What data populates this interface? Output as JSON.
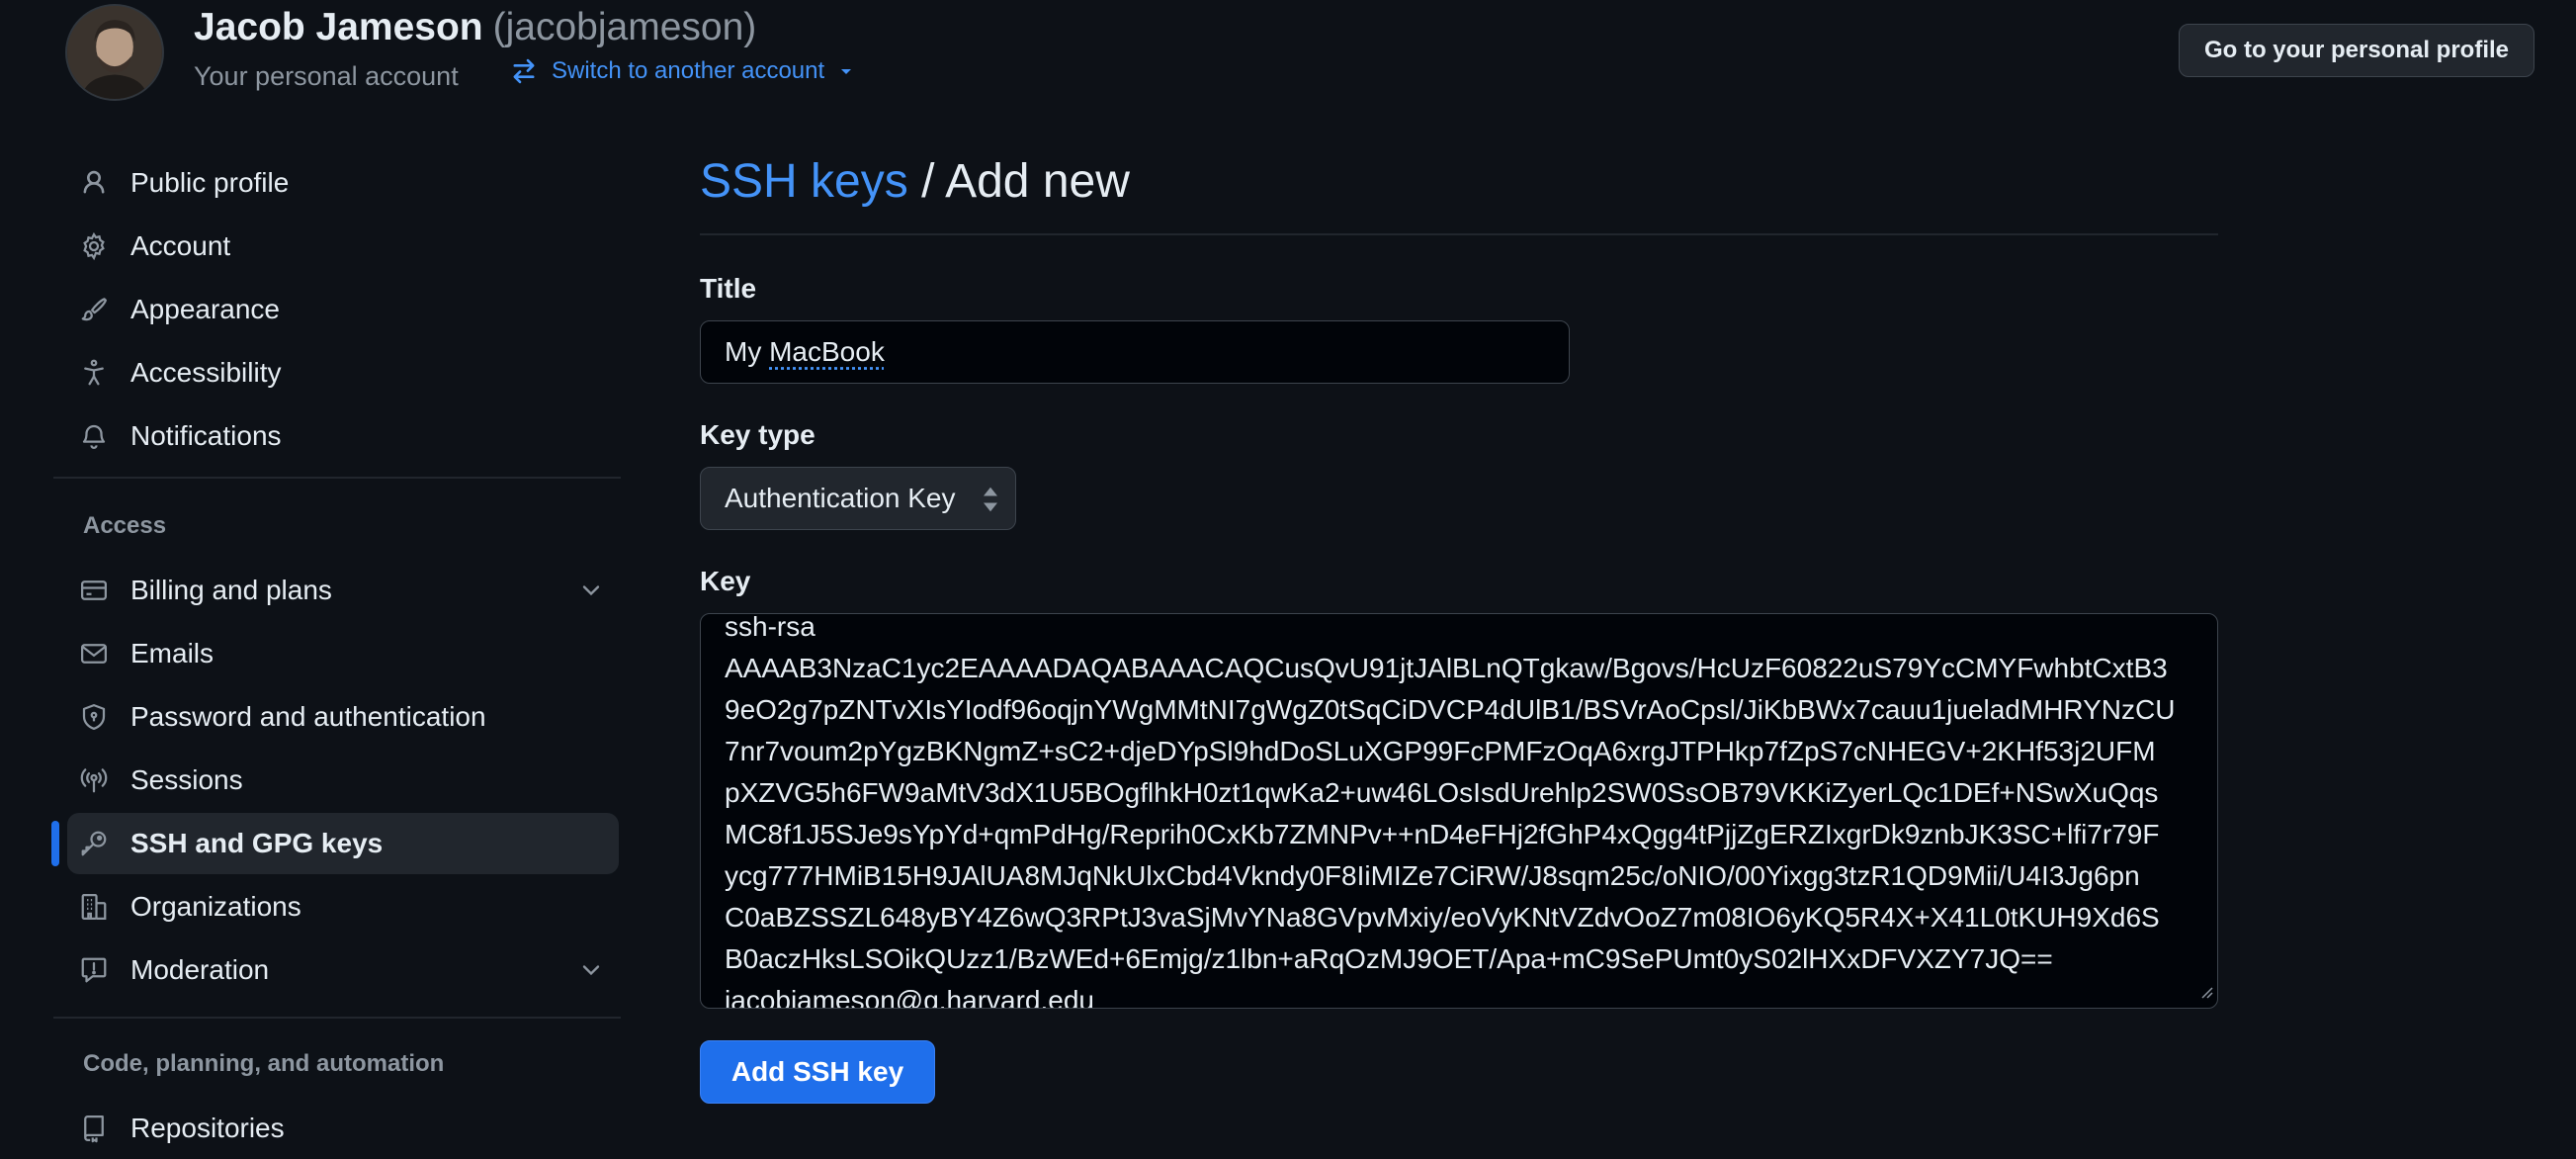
{
  "header": {
    "display_name": "Jacob Jameson",
    "login": "(jacobjameson)",
    "subtitle": "Your personal account",
    "switch_label": "Switch to another account",
    "profile_button": "Go to your personal profile"
  },
  "sidebar": {
    "items": [
      {
        "label": "Public profile",
        "icon": "person-icon"
      },
      {
        "label": "Account",
        "icon": "gear-icon"
      },
      {
        "label": "Appearance",
        "icon": "paintbrush-icon"
      },
      {
        "label": "Accessibility",
        "icon": "accessibility-icon"
      },
      {
        "label": "Notifications",
        "icon": "bell-icon"
      }
    ],
    "access_title": "Access",
    "access_items": [
      {
        "label": "Billing and plans",
        "icon": "credit-card-icon",
        "expandable": true
      },
      {
        "label": "Emails",
        "icon": "mail-icon"
      },
      {
        "label": "Password and authentication",
        "icon": "shield-lock-icon"
      },
      {
        "label": "Sessions",
        "icon": "broadcast-icon"
      },
      {
        "label": "SSH and GPG keys",
        "icon": "key-icon",
        "active": true
      },
      {
        "label": "Organizations",
        "icon": "organization-icon"
      },
      {
        "label": "Moderation",
        "icon": "report-icon",
        "expandable": true
      }
    ],
    "code_title": "Code, planning, and automation",
    "code_items": [
      {
        "label": "Repositories",
        "icon": "repo-icon"
      }
    ]
  },
  "main": {
    "breadcrumb_link": "SSH keys",
    "breadcrumb_sep": " / ",
    "breadcrumb_current": "Add new",
    "title_label": "Title",
    "title_value_prefix": "My ",
    "title_value_word": "MacBook",
    "key_type_label": "Key type",
    "key_type_value": "Authentication Key",
    "key_label": "Key",
    "key_lines": [
      "ssh-rsa",
      "AAAAB3NzaC1yc2EAAAADAQABAAACAQCusQvU91jtJAlBLnQTgkaw/Bgovs/HcUzF60822uS79YcCMYFwhbtCxtB3",
      "9eO2g7pZNTvXIsYIodf96oqjnYWgMMtNI7gWgZ0tSqCiDVCP4dUlB1/BSVrAoCpsl/JiKbBWx7cauu1jueladMHRYNzCU",
      "7nr7voum2pYgzBKNgmZ+sC2+djeDYpSl9hdDoSLuXGP99FcPMFzOqA6xrgJTPHkp7fZpS7cNHEGV+2KHf53j2UFM",
      "pXZVG5h6FW9aMtV3dX1U5BOgflhkH0zt1qwKa2+uw46LOsIsdUrehlp2SW0SsOB79VKKiZyerLQc1DEf+NSwXuQqs",
      "MC8f1J5SJe9sYpYd+qmPdHg/Reprih0CxKb7ZMNPv++nD4eFHj2fGhP4xQgg4tPjjZgERZIxgrDk9znbJK3SC+lfi7r79F",
      "ycg777HMiB15H9JAlUA8MJqNkUlxCbd4Vkndy0F8IiMIZe7CiRW/J8sqm25c/oNIO/00Yixgg3tzR1QD9Mii/U4I3Jg6pn",
      "C0aBZSSZL648yBY4Z6wQ3RPtJ3vaSjMvYNa8GVpvMxiy/eoVyKNtVZdvOoZ7m08IO6yKQ5R4X+X41L0tKUH9Xd6S",
      "B0aczHksLSOikQUzz1/BzWEd+6Emjg/z1lbn+aRqOzMJ9OET/Apa+mC9SePUmt0yS02lHXxDFVXZY7JQ==",
      "jacobjameson@g.harvard.edu"
    ],
    "submit_label": "Add SSH key"
  },
  "colors": {
    "background": "#0d1117",
    "accent": "#4493f8",
    "primary_button": "#1f6feb",
    "muted_text": "#8d96a0"
  }
}
